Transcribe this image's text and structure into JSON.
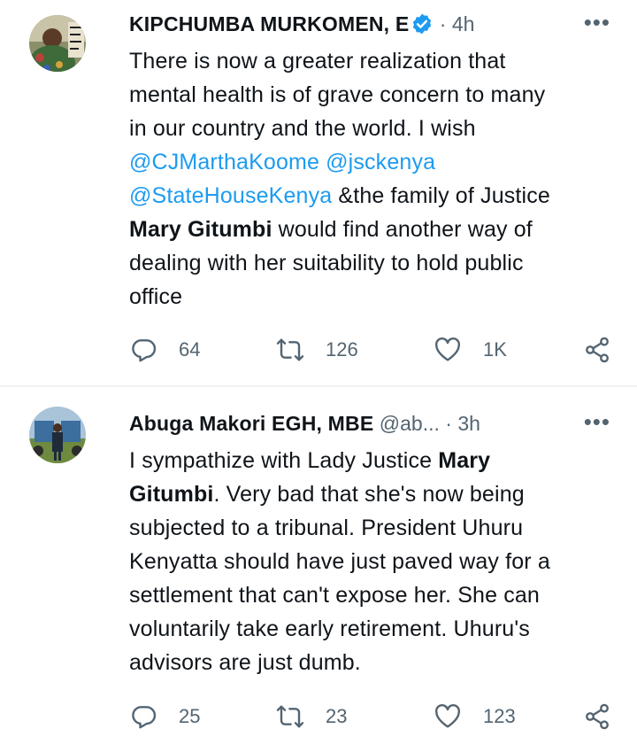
{
  "tweets": [
    {
      "author": "KIPCHUMBA MURKOMEN, E",
      "handle": "",
      "dot": "·",
      "time": "4h",
      "more": "•••",
      "body_lines": [
        [
          "There is now a greater realization that"
        ],
        [
          "mental health is of grave concern to many"
        ],
        [
          "in our country and the world. I wish"
        ],
        [
          "@CJMarthaKoome @jsckenya"
        ],
        [
          "@StateHouseKenya",
          " &the family of Justice"
        ],
        [
          "Mary Gitumbi",
          " would find another way of"
        ],
        [
          "dealing with her suitability to hold public"
        ],
        [
          "office"
        ]
      ],
      "replies": "64",
      "retweets": "126",
      "likes": "1K"
    },
    {
      "author": "Abuga Makori EGH, MBE",
      "handle": "@ab...",
      "dot": "·",
      "time": "3h",
      "more": "•••",
      "body_lines": [
        [
          "I sympathize with Lady Justice ",
          "Mary"
        ],
        [
          "Gitumbi",
          ". Very bad that she's now being"
        ],
        [
          "subjected to a tribunal. President Uhuru"
        ],
        [
          "Kenyatta should have just paved way for a"
        ],
        [
          "settlement that can't expose her. She can"
        ],
        [
          "voluntarily take early retirement. Uhuru's"
        ],
        [
          "advisors are just dumb."
        ]
      ],
      "replies": "25",
      "retweets": "23",
      "likes": "123"
    }
  ],
  "colors": {
    "link": "#1d9bf0",
    "muted": "#536471",
    "text": "#0f1419",
    "verified": "#1d9bf0"
  },
  "icons": [
    "verified-badge-icon",
    "more-icon",
    "reply-icon",
    "retweet-icon",
    "like-icon",
    "share-icon"
  ]
}
